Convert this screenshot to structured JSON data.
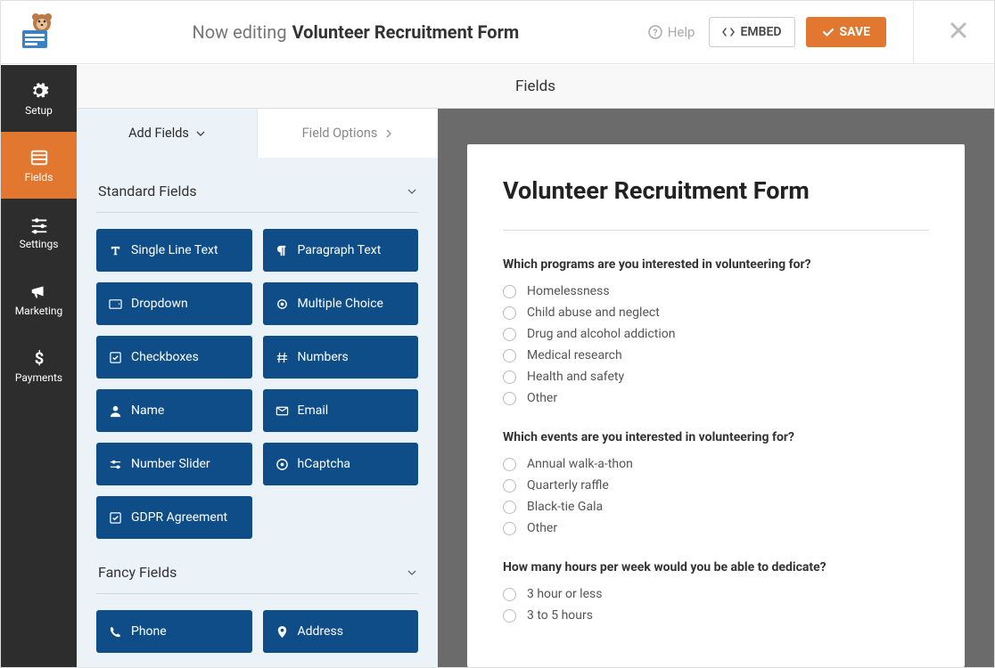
{
  "topbar": {
    "editing_label": "Now editing",
    "form_name": "Volunteer Recruitment Form",
    "help_label": "Help",
    "embed_label": "EMBED",
    "save_label": "SAVE"
  },
  "leftnav": {
    "setup": "Setup",
    "fields": "Fields",
    "settings": "Settings",
    "marketing": "Marketing",
    "payments": "Payments"
  },
  "panel_header": "Fields",
  "fields_tabs": {
    "add_fields": "Add Fields",
    "field_options": "Field Options"
  },
  "sections": {
    "standard": "Standard Fields",
    "fancy": "Fancy Fields"
  },
  "standard_fields": [
    {
      "icon": "text",
      "label": "Single Line Text"
    },
    {
      "icon": "paragraph",
      "label": "Paragraph Text"
    },
    {
      "icon": "dropdown",
      "label": "Dropdown"
    },
    {
      "icon": "multiple",
      "label": "Multiple Choice"
    },
    {
      "icon": "checkbox",
      "label": "Checkboxes"
    },
    {
      "icon": "hash",
      "label": "Numbers"
    },
    {
      "icon": "user",
      "label": "Name"
    },
    {
      "icon": "mail",
      "label": "Email"
    },
    {
      "icon": "slider",
      "label": "Number Slider"
    },
    {
      "icon": "captcha",
      "label": "hCaptcha"
    },
    {
      "icon": "checkbox",
      "label": "GDPR Agreement"
    }
  ],
  "fancy_fields": [
    {
      "icon": "phone",
      "label": "Phone"
    },
    {
      "icon": "pin",
      "label": "Address"
    }
  ],
  "form": {
    "title": "Volunteer Recruitment Form",
    "questions": [
      {
        "text": "Which programs are you interested in volunteering for?",
        "options": [
          "Homelessness",
          "Child abuse and neglect",
          "Drug and alcohol addiction",
          "Medical research",
          "Health and safety",
          "Other"
        ]
      },
      {
        "text": "Which events are you interested in volunteering for?",
        "options": [
          "Annual walk-a-thon",
          "Quarterly raffle",
          "Black-tie Gala",
          "Other"
        ]
      },
      {
        "text": "How many hours per week would you be able to dedicate?",
        "options": [
          "3 hour or less",
          "3 to 5 hours"
        ]
      }
    ]
  }
}
